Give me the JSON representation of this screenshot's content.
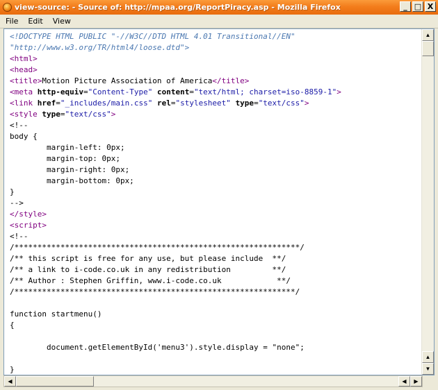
{
  "window": {
    "title": "view-source: - Source of: http://mpaa.org/ReportPiracy.asp - Mozilla Firefox",
    "buttons": {
      "minimize": "_",
      "maximize": "□",
      "close": "X"
    }
  },
  "menu": [
    "File",
    "Edit",
    "View"
  ],
  "source_lines": [
    [
      {
        "c": "doctype",
        "t": "<!DOCTYPE HTML PUBLIC \"-//W3C//DTD HTML 4.01 Transitional//EN\""
      }
    ],
    [
      {
        "c": "doctype",
        "t": "\"http://www.w3.org/TR/html4/loose.dtd\">"
      }
    ],
    [
      {
        "c": "tag",
        "t": "<html>"
      }
    ],
    [
      {
        "c": "tag",
        "t": "<head>"
      }
    ],
    [
      {
        "c": "tag",
        "t": "<title>"
      },
      {
        "c": "plain",
        "t": "Motion Picture Association of America"
      },
      {
        "c": "tag",
        "t": "</title>"
      }
    ],
    [
      {
        "c": "tag",
        "t": "<meta "
      },
      {
        "c": "attr",
        "t": "http-equiv"
      },
      {
        "c": "plain",
        "t": "="
      },
      {
        "c": "val",
        "t": "\"Content-Type\""
      },
      {
        "c": "plain",
        "t": " "
      },
      {
        "c": "attr",
        "t": "content"
      },
      {
        "c": "plain",
        "t": "="
      },
      {
        "c": "val",
        "t": "\"text/html; charset=iso-8859-1\""
      },
      {
        "c": "tag",
        "t": ">"
      }
    ],
    [
      {
        "c": "tag",
        "t": "<link "
      },
      {
        "c": "attr",
        "t": "href"
      },
      {
        "c": "plain",
        "t": "="
      },
      {
        "c": "val",
        "t": "\"_includes/main.css\""
      },
      {
        "c": "plain",
        "t": " "
      },
      {
        "c": "attr",
        "t": "rel"
      },
      {
        "c": "plain",
        "t": "="
      },
      {
        "c": "val",
        "t": "\"stylesheet\""
      },
      {
        "c": "plain",
        "t": " "
      },
      {
        "c": "attr",
        "t": "type"
      },
      {
        "c": "plain",
        "t": "="
      },
      {
        "c": "val",
        "t": "\"text/css\""
      },
      {
        "c": "tag",
        "t": ">"
      }
    ],
    [
      {
        "c": "tag",
        "t": "<style "
      },
      {
        "c": "attr",
        "t": "type"
      },
      {
        "c": "plain",
        "t": "="
      },
      {
        "c": "val",
        "t": "\"text/css\""
      },
      {
        "c": "tag",
        "t": ">"
      }
    ],
    [
      {
        "c": "plain",
        "t": "<!--"
      }
    ],
    [
      {
        "c": "plain",
        "t": "body {"
      }
    ],
    [
      {
        "c": "plain",
        "t": "        margin-left: 0px;"
      }
    ],
    [
      {
        "c": "plain",
        "t": "        margin-top: 0px;"
      }
    ],
    [
      {
        "c": "plain",
        "t": "        margin-right: 0px;"
      }
    ],
    [
      {
        "c": "plain",
        "t": "        margin-bottom: 0px;"
      }
    ],
    [
      {
        "c": "plain",
        "t": "}"
      }
    ],
    [
      {
        "c": "plain",
        "t": "-->"
      }
    ],
    [
      {
        "c": "tag",
        "t": "</style>"
      }
    ],
    [
      {
        "c": "tag",
        "t": "<script>"
      }
    ],
    [
      {
        "c": "plain",
        "t": "<!--"
      }
    ],
    [
      {
        "c": "plain",
        "t": "/**************************************************************/"
      }
    ],
    [
      {
        "c": "plain",
        "t": "/** this script is free for any use, but please include  **/"
      }
    ],
    [
      {
        "c": "plain",
        "t": "/** a link to i-code.co.uk in any redistribution         **/"
      }
    ],
    [
      {
        "c": "plain",
        "t": "/** Author : Stephen Griffin, www.i-code.co.uk            **/"
      }
    ],
    [
      {
        "c": "plain",
        "t": "/*************************************************************/"
      }
    ],
    [
      {
        "c": "plain",
        "t": ""
      }
    ],
    [
      {
        "c": "plain",
        "t": "function startmenu()"
      }
    ],
    [
      {
        "c": "plain",
        "t": "{"
      }
    ],
    [
      {
        "c": "plain",
        "t": ""
      }
    ],
    [
      {
        "c": "plain",
        "t": "        document.getElementById('menu3').style.display = \"none\";"
      }
    ],
    [
      {
        "c": "plain",
        "t": ""
      }
    ],
    [
      {
        "c": "plain",
        "t": "}"
      }
    ]
  ]
}
